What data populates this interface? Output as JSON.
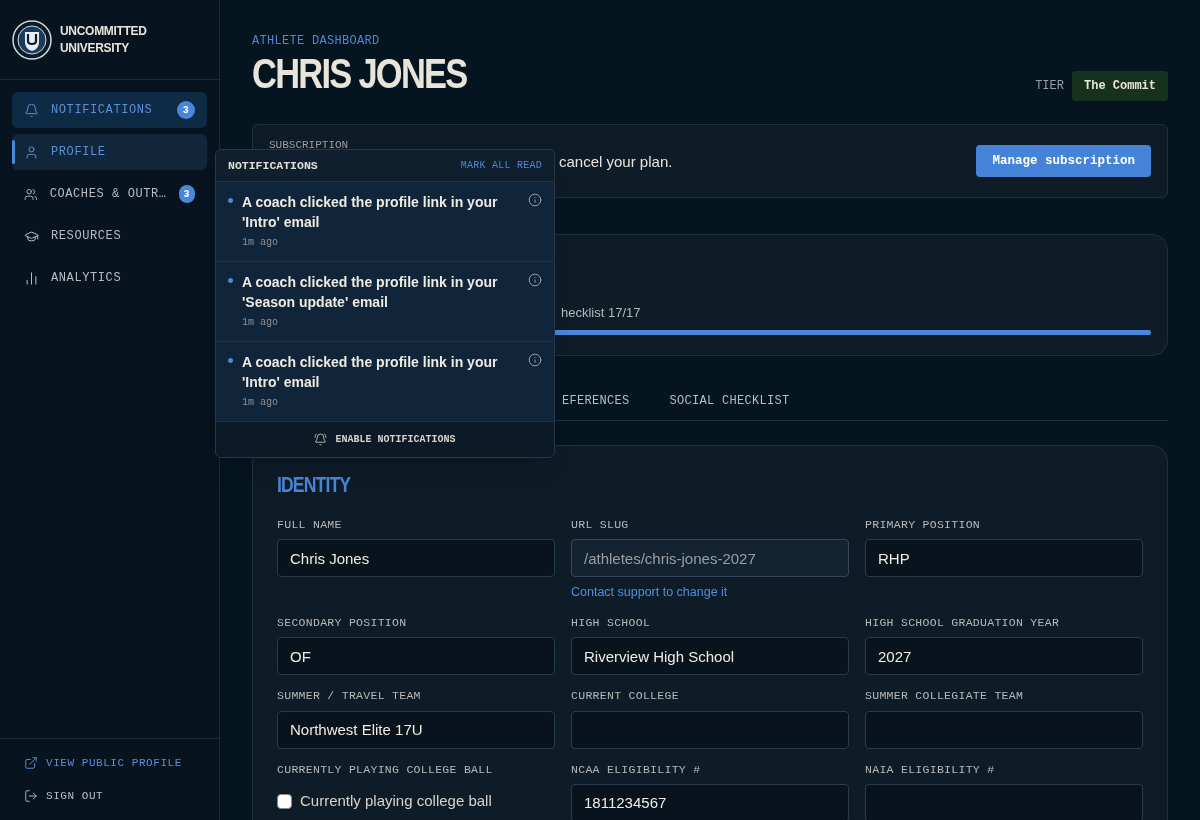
{
  "brand": {
    "line_1": "UNCOMMITTED",
    "line_2": "UNIVERSITY"
  },
  "sidebar": {
    "items": [
      {
        "label": "NOTIFICATIONS",
        "badge": "3",
        "selected": false,
        "open": true
      },
      {
        "label": "PROFILE",
        "selected": true,
        "open": false
      },
      {
        "label": "COACHES & OUTR…",
        "badge": "3",
        "selected": false,
        "open": false
      },
      {
        "label": "RESOURCES",
        "selected": false,
        "open": false
      },
      {
        "label": "ANALYTICS",
        "selected": false,
        "open": false
      }
    ],
    "footer": [
      {
        "label": "VIEW PUBLIC PROFILE",
        "accent": true
      },
      {
        "label": "SIGN OUT",
        "accent": false
      }
    ]
  },
  "header": {
    "eyebrow": "ATHLETE DASHBOARD",
    "title": "CHRIS JONES",
    "tier_label": "TIER",
    "tier": "The Commit"
  },
  "subscription": {
    "label": "SUBSCRIPTION",
    "text": "cancel your plan.",
    "button": "Manage subscription"
  },
  "progress": {
    "text": "hecklist 17/17",
    "level": 1
  },
  "tabs": [
    {
      "label": "EFERENCES",
      "selected": false
    },
    {
      "label": "SOCIAL CHECKLIST",
      "selected": false
    }
  ],
  "identity": {
    "title": "IDENTITY",
    "fields": [
      {
        "kind": "text",
        "label": "FULL NAME",
        "value": "Chris Jones",
        "disabled": false
      },
      {
        "kind": "text",
        "label": "URL SLUG",
        "value": "/athletes/chris-jones-2027",
        "disabled": true,
        "help_link": "Contact support to change it"
      },
      {
        "kind": "text",
        "label": "PRIMARY POSITION",
        "value": "RHP",
        "disabled": false
      },
      {
        "kind": "text",
        "label": "SECONDARY POSITION",
        "value": "OF",
        "disabled": false
      },
      {
        "kind": "text",
        "label": "HIGH SCHOOL",
        "value": "Riverview High School",
        "disabled": false
      },
      {
        "kind": "text",
        "label": "HIGH SCHOOL GRADUATION YEAR",
        "value": "2027",
        "disabled": false
      },
      {
        "kind": "text",
        "label": "SUMMER / TRAVEL TEAM",
        "value": "Northwest Elite 17U",
        "disabled": false
      },
      {
        "kind": "text",
        "label": "CURRENT COLLEGE",
        "disabled": false
      },
      {
        "kind": "text",
        "label": "SUMMER COLLEGIATE TEAM",
        "disabled": false
      },
      {
        "kind": "checkbox",
        "label": "CURRENTLY PLAYING COLLEGE BALL",
        "text": "Currently playing college ball",
        "checked": false
      },
      {
        "kind": "text",
        "label": "NCAA ELIGIBILITY #",
        "value": "1811234567",
        "disabled": false
      },
      {
        "kind": "text",
        "label": "NAIA ELIGIBILITY #",
        "disabled": false
      }
    ]
  },
  "notifications": {
    "title": "NOTIFICATIONS",
    "action": "MARK ALL READ",
    "items": [
      {
        "text": "A coach clicked the profile link in your 'Intro' email",
        "time": "1m ago",
        "unread": true
      },
      {
        "text": "A coach clicked the profile link in your 'Season update' email",
        "time": "1m ago",
        "unread": true
      },
      {
        "text": "A coach clicked the profile link in your 'Intro' email",
        "time": "1m ago",
        "unread": true
      }
    ],
    "footer": "ENABLE NOTIFICATIONS"
  }
}
